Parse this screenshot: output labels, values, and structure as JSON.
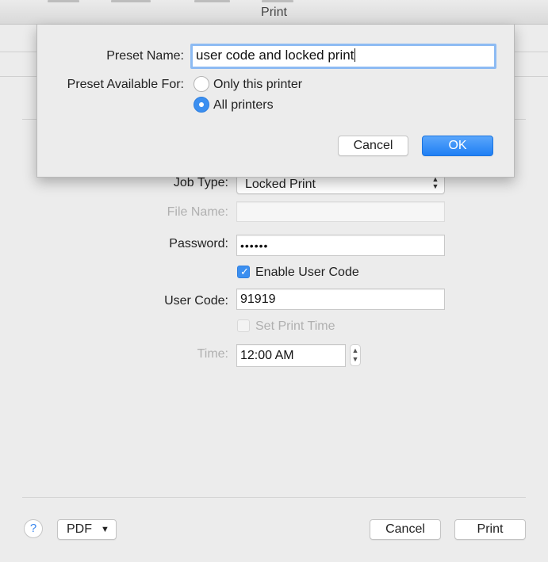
{
  "window": {
    "title": "Print"
  },
  "print_form": {
    "job_type": {
      "label": "Job Type:",
      "value": "Locked Print"
    },
    "file_name": {
      "label": "File Name:",
      "value": ""
    },
    "password": {
      "label": "Password:",
      "value": "••••••"
    },
    "enable_user_code": {
      "label": "Enable User Code",
      "checked": true
    },
    "user_code": {
      "label": "User Code:",
      "value": "91919"
    },
    "set_print_time": {
      "label": "Set Print Time",
      "checked": false,
      "enabled": false
    },
    "time": {
      "label": "Time:",
      "value": "12:00 AM"
    }
  },
  "footer": {
    "help_label": "?",
    "pdf_label": "PDF",
    "cancel_label": "Cancel",
    "print_label": "Print"
  },
  "preset_sheet": {
    "name_label": "Preset Name:",
    "name_value": "user code and locked print",
    "available_label": "Preset Available For:",
    "options": [
      {
        "label": "Only this printer",
        "selected": false
      },
      {
        "label": "All printers",
        "selected": true
      }
    ],
    "cancel_label": "Cancel",
    "ok_label": "OK"
  },
  "colors": {
    "accent": "#3b8ff0",
    "disabled_text": "#b0b0b0"
  }
}
